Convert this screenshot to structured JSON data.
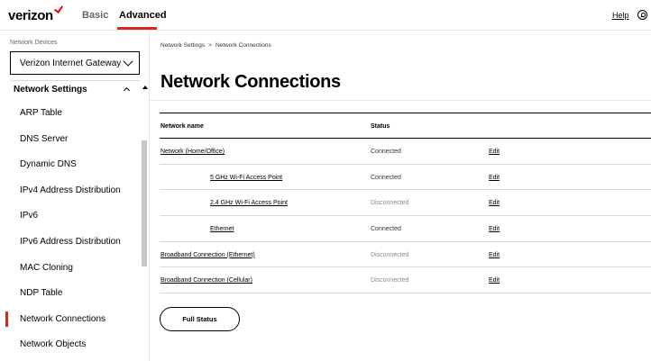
{
  "header": {
    "logo_text": "verizon",
    "tabs": [
      {
        "label": "Basic"
      },
      {
        "label": "Advanced"
      }
    ],
    "help_label": "Help",
    "accent_color": "#d52b1e"
  },
  "sidebar": {
    "device_label": "Network Devices",
    "device_selected": "Verizon Internet Gateway",
    "section_title": "Network Settings",
    "items": [
      {
        "label": "ARP Table"
      },
      {
        "label": "DNS Server"
      },
      {
        "label": "Dynamic DNS"
      },
      {
        "label": "IPv4 Address Distribution"
      },
      {
        "label": "IPv6"
      },
      {
        "label": "IPv6 Address Distribution"
      },
      {
        "label": "MAC Cloning"
      },
      {
        "label": "NDP Table"
      },
      {
        "label": "Network Connections"
      },
      {
        "label": "Network Objects"
      }
    ],
    "active_item": "Network Connections"
  },
  "main": {
    "breadcrumb": [
      "Network Settings",
      "Network Connections"
    ],
    "breadcrumb_separator": ">",
    "title": "Network Connections",
    "table": {
      "headers": [
        "Network name",
        "Status"
      ],
      "rows": [
        {
          "name": "Network (Home/Office)",
          "status": "Connected",
          "action": "Edit"
        },
        {
          "name": "5 GHz Wi-Fi Access Point",
          "status": "Connected",
          "action": "Edit"
        },
        {
          "name": "2.4 GHz Wi-Fi Access Point",
          "status": "Disconnected",
          "action": "Edit"
        },
        {
          "name": "Ethernet",
          "status": "Connected",
          "action": "Edit"
        },
        {
          "name": "Broadband Connection (Ethernet)",
          "status": "Disconnected",
          "action": "Edit"
        },
        {
          "name": "Broadband Connection (Cellular)",
          "status": "Disconnected",
          "action": "Edit"
        }
      ]
    },
    "full_status_label": "Full Status"
  }
}
